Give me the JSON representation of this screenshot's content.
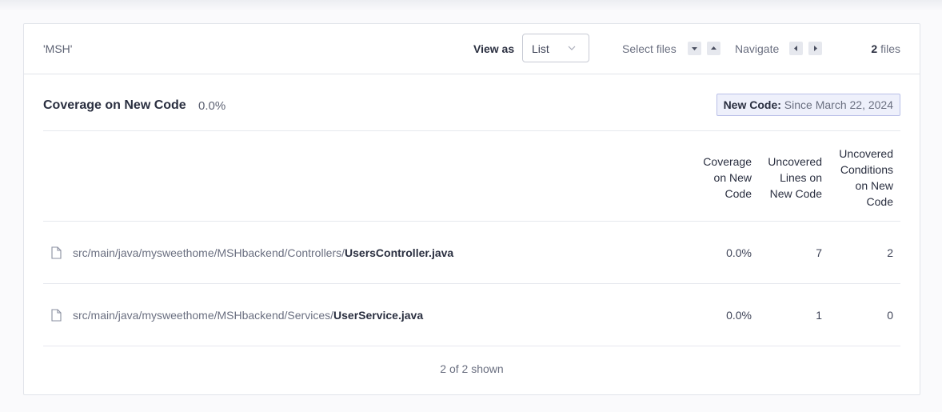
{
  "header": {
    "project": "'MSH'",
    "view_as_label": "View as",
    "view_mode": "List",
    "select_files_label": "Select files",
    "navigate_label": "Navigate",
    "files_count": "2",
    "files_label": "files"
  },
  "summary": {
    "title": "Coverage on New Code",
    "value": "0.0%",
    "new_code_label": "New Code:",
    "new_code_value": "Since March 22, 2024"
  },
  "table": {
    "columns": [
      {
        "lines": [
          "Coverage",
          "on New",
          "Code"
        ]
      },
      {
        "lines": [
          "Uncovered",
          "Lines on",
          "New Code"
        ]
      },
      {
        "lines": [
          "Uncovered",
          "Conditions",
          "on New",
          "Code"
        ]
      }
    ],
    "rows": [
      {
        "dir": "src/main/java/mysweethome/MSHbackend/Controllers/",
        "file": "UsersController.java",
        "coverage": "0.0%",
        "uncovered_lines": "7",
        "uncovered_conditions": "2"
      },
      {
        "dir": "src/main/java/mysweethome/MSHbackend/Services/",
        "file": "UserService.java",
        "coverage": "0.0%",
        "uncovered_lines": "1",
        "uncovered_conditions": "0"
      }
    ]
  },
  "footer": {
    "shown": "2 of 2 shown"
  },
  "icons": {
    "file": "file-icon",
    "chevron": "chevron-down-icon",
    "arrow_down": "caret-down-icon",
    "arrow_up": "caret-up-icon",
    "arrow_left": "caret-left-icon",
    "arrow_right": "caret-right-icon"
  },
  "colors": {
    "badge_bg": "#eef0fb",
    "badge_border": "#b9bfe8",
    "text_dark": "#2a2f40",
    "text_muted": "#6a6f80"
  }
}
